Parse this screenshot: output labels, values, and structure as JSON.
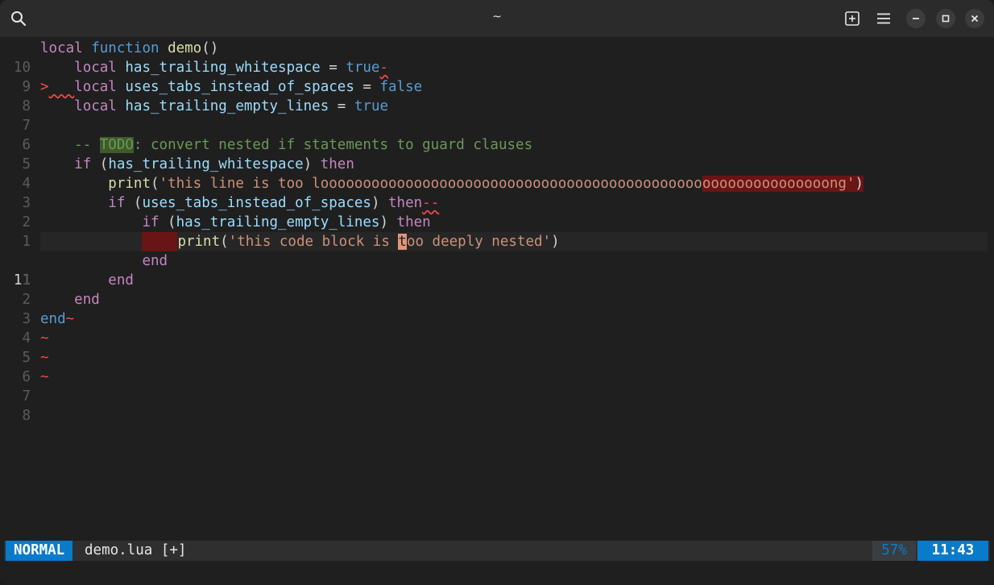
{
  "window": {
    "title": "~"
  },
  "statusline": {
    "mode": "NORMAL",
    "filename": "demo.lua [+]",
    "percent": "57%",
    "position": "11:43"
  },
  "gutter": [
    "10",
    "9",
    "8",
    "7",
    "6",
    "5",
    "4",
    "3",
    "2",
    "1",
    "11",
    "1",
    "2",
    "3",
    "4",
    "5",
    "6",
    "7",
    "8"
  ],
  "code": {
    "l0": {
      "kw_local": "local",
      "kw_function": "function",
      "name": "demo",
      "parens": "()"
    },
    "l1": {
      "indent": "    ",
      "kw": "local",
      "var": "has_trailing_whitespace",
      "eq": " = ",
      "val": "true",
      "trail": "-"
    },
    "l2": {
      "marker": ">",
      "indent": "   ",
      "kw": "local",
      "var": "uses_tabs_instead_of_spaces",
      "eq": " = ",
      "val": "false"
    },
    "l3": {
      "indent": "    ",
      "kw": "local",
      "var": "has_trailing_empty_lines",
      "eq": " = ",
      "val": "true"
    },
    "l5": {
      "indent": "    ",
      "dash": "-- ",
      "todo": "TODO",
      "rest": ": convert nested if statements to guard clauses"
    },
    "l6": {
      "indent": "    ",
      "kw": "if",
      "open": " (",
      "var": "has_trailing_whitespace",
      "close": ") ",
      "then": "then"
    },
    "l7": {
      "indent": "        ",
      "fn": "print",
      "open": "(",
      "str_a": "'this line is too looooooooooooooooooooooooooooooooooooooooooooo",
      "str_b": "ooooooooooooooong'",
      "close": ")"
    },
    "l8": {
      "indent": "        ",
      "kw": "if",
      "open": " (",
      "var": "uses_tabs_instead_of_spaces",
      "close": ") ",
      "then": "then",
      "trail": "--"
    },
    "l9": {
      "indent": "            ",
      "kw": "if",
      "open": " (",
      "var": "has_trailing_empty_lines",
      "close": ") ",
      "then": "then"
    },
    "l10": {
      "indent": "            ",
      "fn": "print",
      "open": "(",
      "str_a": "'this code block is ",
      "cursor_char": "t",
      "str_b": "oo deeply nested'",
      "close": ")"
    },
    "l11": {
      "indent": "            ",
      "kw": "end"
    },
    "l12": {
      "indent": "        ",
      "kw": "end"
    },
    "l13": {
      "indent": "    ",
      "kw": "end"
    },
    "l14": {
      "kw": "end",
      "trail": "~"
    },
    "tilde": "~"
  },
  "colors": {
    "accent": "#0a7aca",
    "error": "#f14c4c",
    "error_bg": "#6a1515",
    "todo_bg": "#3f5a2b",
    "cursor": "#e0967a"
  },
  "icons": {
    "search": "search-icon",
    "new_tab": "new-tab-icon",
    "menu": "hamburger-menu-icon",
    "minimize": "minimize-icon",
    "maximize": "maximize-icon",
    "close": "close-icon"
  }
}
